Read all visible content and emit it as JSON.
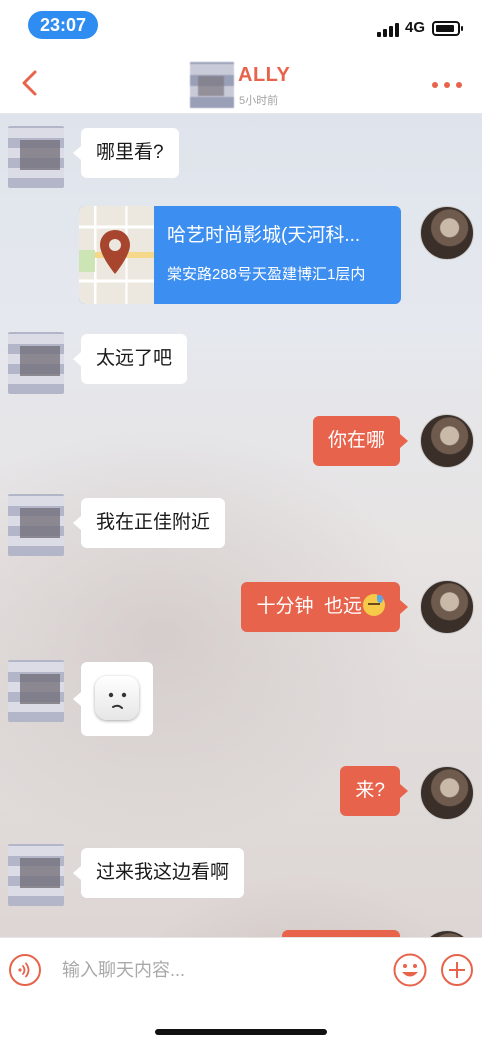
{
  "status_bar": {
    "time": "23:07",
    "network": "4G",
    "icons": [
      "signal-icon",
      "battery-icon"
    ]
  },
  "header": {
    "name": "ALLY",
    "last_seen": "5小时前",
    "accent_color": "#e8634b",
    "icons": [
      "back-icon",
      "more-icon"
    ]
  },
  "messages": [
    {
      "side": "in",
      "type": "text",
      "text": "哪里看?"
    },
    {
      "side": "out",
      "type": "location",
      "title": "哈艺时尚影城(天河科...",
      "address": "棠安路288号天盈建博汇1层内"
    },
    {
      "side": "in",
      "type": "text",
      "text": "太远了吧"
    },
    {
      "side": "out",
      "type": "text",
      "text": "你在哪"
    },
    {
      "side": "in",
      "type": "text",
      "text": "我在正佳附近"
    },
    {
      "side": "out",
      "type": "text",
      "text": "十分钟  也远",
      "emoji": "sweat-emoji"
    },
    {
      "side": "in",
      "type": "sticker",
      "sticker": "unamused-face-sticker"
    },
    {
      "side": "out",
      "type": "text",
      "text": "来?"
    },
    {
      "side": "in",
      "type": "text",
      "text": "过来我这边看啊"
    }
  ],
  "input_bar": {
    "placeholder": "输入聊天内容...",
    "icons": [
      "voice-icon",
      "emoji-icon",
      "plus-icon"
    ]
  },
  "colors": {
    "outgoing_bubble": "#e8634b",
    "location_card": "#3c8ef0",
    "time_pill": "#2f8cf0"
  }
}
